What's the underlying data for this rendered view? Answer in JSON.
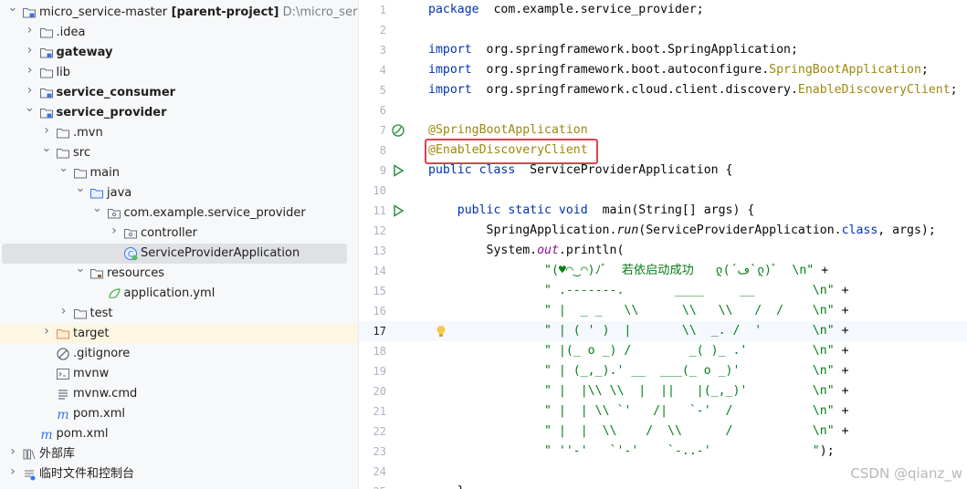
{
  "project_tree": {
    "items": [
      {
        "label": "micro_service-master",
        "suffix": "[parent-project]",
        "path": "D:\\micro_service-",
        "icon": "module-folder-icon",
        "indent": 0,
        "expanded": true,
        "bold": false
      },
      {
        "label": ".idea",
        "icon": "folder-icon",
        "indent": 1,
        "expanded": false
      },
      {
        "label": "gateway",
        "icon": "module-folder-icon",
        "indent": 1,
        "expanded": false,
        "bold": true
      },
      {
        "label": "lib",
        "icon": "folder-icon",
        "indent": 1,
        "expanded": false
      },
      {
        "label": "service_consumer",
        "icon": "module-folder-icon",
        "indent": 1,
        "expanded": false,
        "bold": true
      },
      {
        "label": "service_provider",
        "icon": "module-folder-icon",
        "indent": 1,
        "expanded": true,
        "bold": true
      },
      {
        "label": ".mvn",
        "icon": "folder-icon",
        "indent": 2,
        "expanded": false
      },
      {
        "label": "src",
        "icon": "folder-icon",
        "indent": 2,
        "expanded": true
      },
      {
        "label": "main",
        "icon": "folder-icon",
        "indent": 3,
        "expanded": true
      },
      {
        "label": "java",
        "icon": "source-folder-icon",
        "indent": 4,
        "expanded": true
      },
      {
        "label": "com.example.service_provider",
        "icon": "package-icon",
        "indent": 5,
        "expanded": true
      },
      {
        "label": "controller",
        "icon": "package-icon",
        "indent": 6,
        "expanded": false
      },
      {
        "label": "ServiceProviderApplication",
        "icon": "spring-class-icon",
        "indent": 6,
        "leaf": true,
        "selected": true
      },
      {
        "label": "resources",
        "icon": "resources-folder-icon",
        "indent": 4,
        "expanded": true
      },
      {
        "label": "application.yml",
        "icon": "spring-config-icon",
        "indent": 5,
        "leaf": true
      },
      {
        "label": "test",
        "icon": "folder-icon",
        "indent": 3,
        "expanded": false
      },
      {
        "label": "target",
        "icon": "excluded-folder-icon",
        "indent": 2,
        "expanded": false,
        "highlight": true
      },
      {
        "label": ".gitignore",
        "icon": "ignore-file-icon",
        "indent": 2,
        "leaf": true
      },
      {
        "label": "mvnw",
        "icon": "terminal-file-icon",
        "indent": 2,
        "leaf": true
      },
      {
        "label": "mvnw.cmd",
        "icon": "text-file-icon",
        "indent": 2,
        "leaf": true
      },
      {
        "label": "pom.xml",
        "icon": "maven-icon",
        "indent": 2,
        "leaf": true
      },
      {
        "label": "pom.xml",
        "icon": "maven-icon",
        "indent": 1,
        "leaf": true
      },
      {
        "label": "外部库",
        "icon": "library-icon",
        "indent": 0,
        "expanded": false
      },
      {
        "label": "临时文件和控制台",
        "icon": "scratches-icon",
        "indent": 0,
        "expanded": false
      }
    ]
  },
  "editor": {
    "current_line": 17,
    "lines": [
      {
        "n": "1",
        "segs": [
          [
            "kw",
            "package"
          ],
          [
            "",
            "  com.example.service_provider;"
          ]
        ]
      },
      {
        "n": "2",
        "segs": []
      },
      {
        "n": "3",
        "segs": [
          [
            "kw",
            "import"
          ],
          [
            "",
            "  org.springframework.boot.SpringApplication;"
          ]
        ]
      },
      {
        "n": "4",
        "segs": [
          [
            "kw",
            "import"
          ],
          [
            "",
            "  org.springframework.boot.autoconfigure."
          ],
          [
            "an",
            "SpringBootApplication"
          ],
          [
            "",
            ";"
          ]
        ]
      },
      {
        "n": "5",
        "segs": [
          [
            "kw",
            "import"
          ],
          [
            "",
            "  org.springframework.cloud.client.discovery."
          ],
          [
            "an",
            "EnableDiscoveryClient"
          ],
          [
            "",
            ";"
          ]
        ]
      },
      {
        "n": "6",
        "segs": []
      },
      {
        "n": "7",
        "segs": [
          [
            "an",
            "@SpringBootApplication"
          ]
        ],
        "gutter": "spring-bean-icon"
      },
      {
        "n": "8",
        "segs": [
          [
            "an",
            "@EnableDiscoveryClient"
          ]
        ]
      },
      {
        "n": "9",
        "segs": [
          [
            "kw",
            "public class"
          ],
          [
            "",
            "  ServiceProviderApplication {"
          ]
        ],
        "gutter": "run-icon"
      },
      {
        "n": "10",
        "segs": []
      },
      {
        "n": "11",
        "segs": [
          [
            "",
            "    "
          ],
          [
            "kw",
            "public static void"
          ],
          [
            "",
            "  main(String[] args) {"
          ]
        ],
        "gutter": "run-icon"
      },
      {
        "n": "12",
        "segs": [
          [
            "",
            "        SpringApplication."
          ],
          [
            "it",
            "run"
          ],
          [
            "",
            "(ServiceProviderApplication."
          ],
          [
            "kw",
            "class"
          ],
          [
            "",
            ", args);"
          ]
        ]
      },
      {
        "n": "13",
        "segs": [
          [
            "",
            "        System."
          ],
          [
            "fld",
            "out"
          ],
          [
            "",
            ".println("
          ]
        ]
      },
      {
        "n": "14",
        "segs": [
          [
            "",
            "                "
          ],
          [
            "st",
            "\"(♥◠‿◠)ﾉﾞ  若依启动成功   ლ(´ڡ`ლ)ﾞ  \\n\""
          ],
          [
            "",
            " +"
          ]
        ]
      },
      {
        "n": "15",
        "segs": [
          [
            "",
            "                "
          ],
          [
            "st",
            "\" .-------.       ____     __        \\n\""
          ],
          [
            "",
            " +"
          ]
        ]
      },
      {
        "n": "16",
        "segs": [
          [
            "",
            "                "
          ],
          [
            "st",
            "\" |  _ _   \\\\      \\\\   \\\\   /  /    \\n\""
          ],
          [
            "",
            " +"
          ]
        ]
      },
      {
        "n": "17",
        "segs": [
          [
            "",
            "                "
          ],
          [
            "st",
            "\" | ( ' )  |       \\\\  _. /  '       \\n\""
          ],
          [
            "",
            " +"
          ]
        ],
        "gutter2": "lightbulb-icon"
      },
      {
        "n": "18",
        "segs": [
          [
            "",
            "                "
          ],
          [
            "st",
            "\" |(_ o _) /        _( )_ .'         \\n\""
          ],
          [
            "",
            " +"
          ]
        ]
      },
      {
        "n": "19",
        "segs": [
          [
            "",
            "                "
          ],
          [
            "st",
            "\" | (_,_).' __  ___(_ o _)'          \\n\""
          ],
          [
            "",
            " +"
          ]
        ]
      },
      {
        "n": "20",
        "segs": [
          [
            "",
            "                "
          ],
          [
            "st",
            "\" |  |\\\\ \\\\  |  ||   |(_,_)'         \\n\""
          ],
          [
            "",
            " +"
          ]
        ]
      },
      {
        "n": "21",
        "segs": [
          [
            "",
            "                "
          ],
          [
            "st",
            "\" |  | \\\\ `'   /|   `-'  /           \\n\""
          ],
          [
            "",
            " +"
          ]
        ]
      },
      {
        "n": "22",
        "segs": [
          [
            "",
            "                "
          ],
          [
            "st",
            "\" |  |  \\\\    /  \\\\      /           \\n\""
          ],
          [
            "",
            " +"
          ]
        ]
      },
      {
        "n": "23",
        "segs": [
          [
            "",
            "                "
          ],
          [
            "st",
            "\" ''-'   `'-'    `-..-'              \""
          ],
          [
            "",
            ");"
          ]
        ]
      },
      {
        "n": "24",
        "segs": []
      },
      {
        "n": "25",
        "segs": [
          [
            "",
            "    }"
          ]
        ]
      }
    ]
  },
  "watermark": "CSDN @qianz_w",
  "colors": {
    "highlight_box": "#e0414c",
    "keyword": "#0033b3",
    "annotation": "#9e880d",
    "string": "#067d17"
  }
}
